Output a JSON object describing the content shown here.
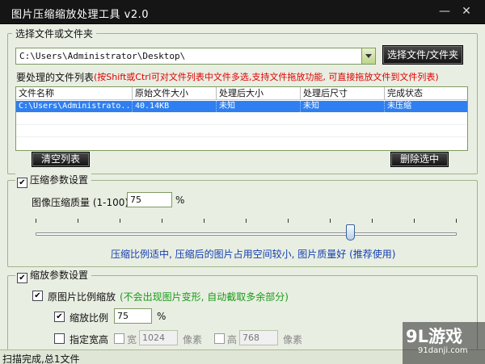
{
  "window": {
    "title": "图片压缩缩放处理工具 v2.0",
    "min_glyph": "—",
    "close_glyph": "✕"
  },
  "source": {
    "group_title": "选择文件或文件夹",
    "path_value": "C:\\Users\\Administrator\\Desktop\\",
    "browse_label": "选择文件/文件夹"
  },
  "filelist": {
    "label": "要处理的文件列表",
    "hint": "(按Shift或Ctrl可对文件列表中文件多选,支持文件拖放功能, 可直接拖放文件到文件列表)",
    "columns": [
      "文件名称",
      "原始文件大小",
      "处理后大小",
      "处理后尺寸",
      "完成状态"
    ],
    "rows": [
      {
        "name": "C:\\Users\\Administrato...",
        "orig_size": "40.14KB",
        "new_size": "未知",
        "new_dim": "未知",
        "status": "未压缩"
      }
    ],
    "clear_label": "清空列表",
    "delete_label": "删除选中"
  },
  "compress": {
    "group_title": "压缩参数设置",
    "checked": true,
    "quality_label": "图像压缩质量 (1-100):",
    "quality_value": "75",
    "percent": "%",
    "slider_value": 75,
    "desc": "压缩比例适中, 压缩后的图片占用空间较小, 图片质量好 (推荐使用)"
  },
  "scale": {
    "group_title": "缩放参数设置",
    "checked": true,
    "keep_ratio_label": "原图片比例缩放",
    "keep_ratio_hint": "(不会出现图片变形, 自动截取多余部分)",
    "keep_ratio_checked": true,
    "ratio_label": "缩放比例",
    "ratio_checked": true,
    "ratio_value": "75",
    "ratio_unit": "%",
    "fixed_label": "指定宽高",
    "fixed_checked": false,
    "width_label": "宽",
    "width_value": "1024",
    "width_unit": "像素",
    "height_label": "高",
    "height_value": "768",
    "height_unit": "像素"
  },
  "status_bar": {
    "text": "扫描完成,总1文件"
  },
  "watermark": {
    "brand": "9L游戏",
    "site": "91danji.com"
  },
  "colors": {
    "title_bar": "#151515",
    "selection": "#2f7ff0",
    "hint_red": "#e00000",
    "desc_blue": "#143fb0",
    "hint_green": "#1a9a1a"
  }
}
